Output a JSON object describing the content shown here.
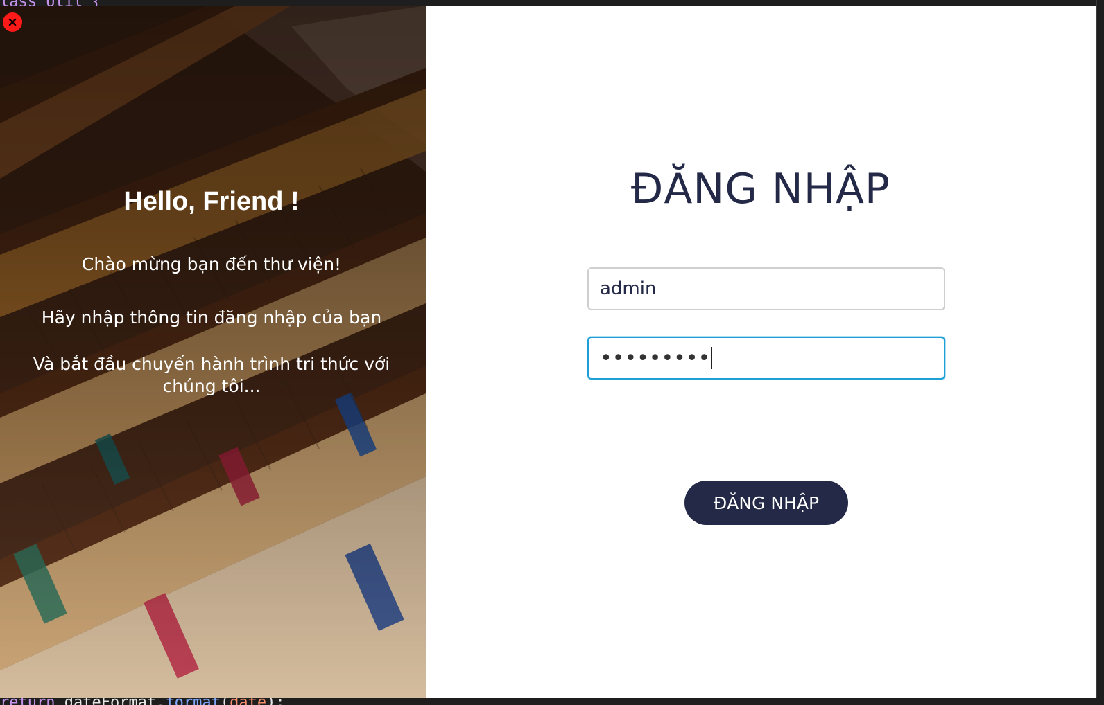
{
  "editor": {
    "top_code": "lass Util {",
    "bottom_keyword": "return",
    "bottom_object": " dateFormat.",
    "bottom_method": "format",
    "bottom_arg": "date",
    "bottom_tail": ");"
  },
  "welcome": {
    "title": "Hello, Friend !",
    "line1": "Chào mừng bạn đến thư viện!",
    "line2": "Hãy nhập thông tin đăng nhập của bạn",
    "line3": "Và bắt đầu chuyến hành trình tri thức với chúng tôi..."
  },
  "login": {
    "title": "ĐĂNG NHẬP",
    "username_value": "admin",
    "password_mask": "•••••••••",
    "submit_label": "ĐĂNG NHẬP"
  },
  "colors": {
    "primary": "#232946",
    "focus_border": "#1ea0d6",
    "close": "#ff1a1a"
  },
  "icons": {
    "close": "close-icon"
  }
}
